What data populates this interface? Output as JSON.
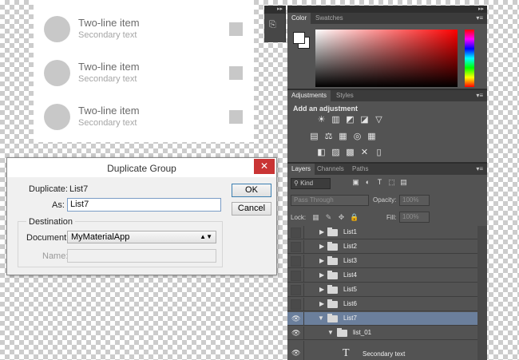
{
  "canvas": {
    "items": [
      {
        "primary": "Two-line item",
        "secondary": "Secondary text"
      },
      {
        "primary": "Two-line item",
        "secondary": "Secondary text"
      },
      {
        "primary": "Two-line item",
        "secondary": "Secondary text"
      }
    ]
  },
  "dialog": {
    "title": "Duplicate Group",
    "close_glyph": "✕",
    "duplicate_label": "Duplicate:",
    "duplicate_value": "List7",
    "as_label": "As:",
    "as_value": "List7",
    "destination_legend": "Destination",
    "document_label": "Document:",
    "document_value": "MyMaterialApp",
    "name_label": "Name:",
    "name_value": "",
    "ok_label": "OK",
    "cancel_label": "Cancel"
  },
  "photoshop": {
    "collapse_glyph": "▸▸",
    "color_tabs": [
      "Color",
      "Swatches"
    ],
    "adjust_tabs": [
      "Adjustments",
      "Styles"
    ],
    "adjust_title": "Add an adjustment",
    "adjust_rows": [
      [
        "☀",
        "▥",
        "◩",
        "◪",
        "▽"
      ],
      [
        "▤",
        "⚖",
        "▦",
        "◎",
        "▦"
      ],
      [
        "◧",
        "▨",
        "▩",
        "✕",
        "▯"
      ]
    ],
    "layers_tabs": [
      "Layers",
      "Channels",
      "Paths"
    ],
    "kind_label": "Kind",
    "filter_icons": [
      "▣",
      "◐",
      "T",
      "⬚",
      "▤"
    ],
    "blend_mode": "Pass Through",
    "opacity_label": "Opacity:",
    "opacity_value": "100%",
    "lock_label": "Lock:",
    "lock_icons": [
      "▦",
      "✎",
      "✥",
      "🔒"
    ],
    "fill_label": "Fill:",
    "fill_value": "100%",
    "layers": [
      {
        "name": "List1",
        "expanded": false,
        "visible": false
      },
      {
        "name": "List2",
        "expanded": false,
        "visible": false
      },
      {
        "name": "List3",
        "expanded": false,
        "visible": false
      },
      {
        "name": "List4",
        "expanded": false,
        "visible": false
      },
      {
        "name": "List5",
        "expanded": false,
        "visible": false
      },
      {
        "name": "List6",
        "expanded": false,
        "visible": false
      },
      {
        "name": "List7",
        "expanded": true,
        "visible": true,
        "selected": true
      },
      {
        "name": "list_01",
        "expanded": true,
        "visible": true,
        "indent": 1
      },
      {
        "name": "Secondary text",
        "type": "text",
        "visible": true,
        "indent": 2
      }
    ],
    "colors": {
      "panel_bg": "#535353",
      "selected_row": "#6b7f9c",
      "dialog_close": "#c93434"
    }
  }
}
